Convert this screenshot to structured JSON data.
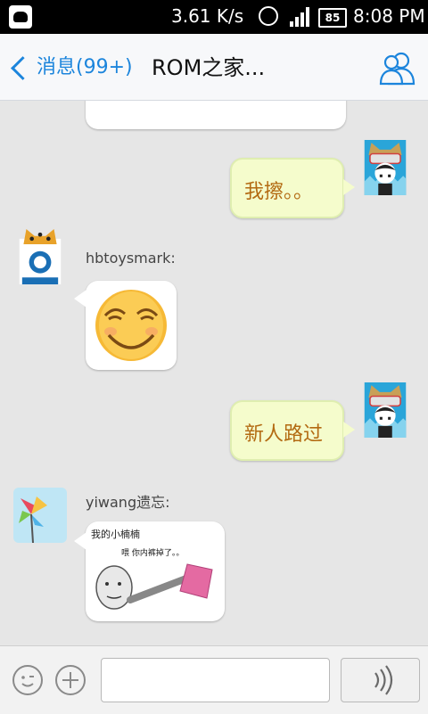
{
  "status_bar": {
    "speed": "3.61 K/s",
    "battery": "85",
    "time": "8:08 PM",
    "icons": [
      "app-icon",
      "alarm-icon",
      "signal-icon",
      "battery-icon"
    ]
  },
  "header": {
    "back_label": "消息(99+)",
    "title": "ROM之家...",
    "right_icon": "group-members-icon"
  },
  "messages": [
    {
      "direction": "incoming",
      "type": "image",
      "note": "partially visible"
    },
    {
      "direction": "outgoing",
      "type": "text",
      "text": "我擦。。"
    },
    {
      "direction": "incoming",
      "sender": "hbtoysmark:",
      "type": "emoji",
      "emoji": "smirk-face"
    },
    {
      "direction": "outgoing",
      "type": "text",
      "text": "新人路过"
    },
    {
      "direction": "incoming",
      "sender": "yiwang遗忘:",
      "type": "image",
      "caption_top": "我的小楠楠",
      "caption_inner": "喂 你内裤掉了。。"
    }
  ],
  "bottom_bar": {
    "input_value": "",
    "icons": [
      "emoji-icon",
      "plus-icon",
      "voice-icon"
    ]
  },
  "colors": {
    "accent": "#1c85dc",
    "outgoing_bubble": "#f5fccc",
    "outgoing_text": "#b36a12",
    "chat_bg": "#e6e6e6"
  }
}
